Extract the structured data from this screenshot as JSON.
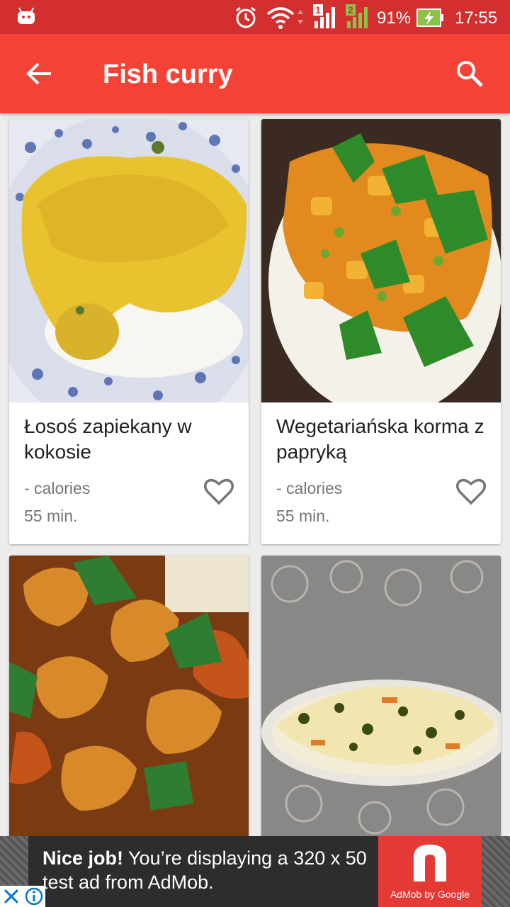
{
  "status_bar": {
    "battery_percent": "91%",
    "time": "17:55",
    "sim1": "1",
    "sim2": "2",
    "icons": [
      "android-icon",
      "alarm-icon",
      "wifi-icon",
      "signal-icon",
      "battery-charging-icon"
    ]
  },
  "app_bar": {
    "title": "Fish curry",
    "back_icon": "arrow-back-icon",
    "search_icon": "search-icon"
  },
  "recipes": [
    {
      "name": "Łosoś zapiekany w kokosie",
      "calories": "- calories",
      "time": "55 min.",
      "favorite": false
    },
    {
      "name": "Wegetariańska korma z papryką",
      "calories": "- calories",
      "time": "55 min.",
      "favorite": false
    },
    {
      "name": "",
      "calories": "",
      "time": "",
      "favorite": false
    },
    {
      "name": "",
      "calories": "",
      "time": "",
      "favorite": false
    }
  ],
  "ad": {
    "headline": "Nice job!",
    "body": " You’re displaying a 320 x 50 test ad from AdMob.",
    "logo_label": "AdMob by Google"
  },
  "colors": {
    "status_bar": "#d32f2f",
    "app_bar": "#f44336",
    "ad_logo": "#e53935"
  }
}
